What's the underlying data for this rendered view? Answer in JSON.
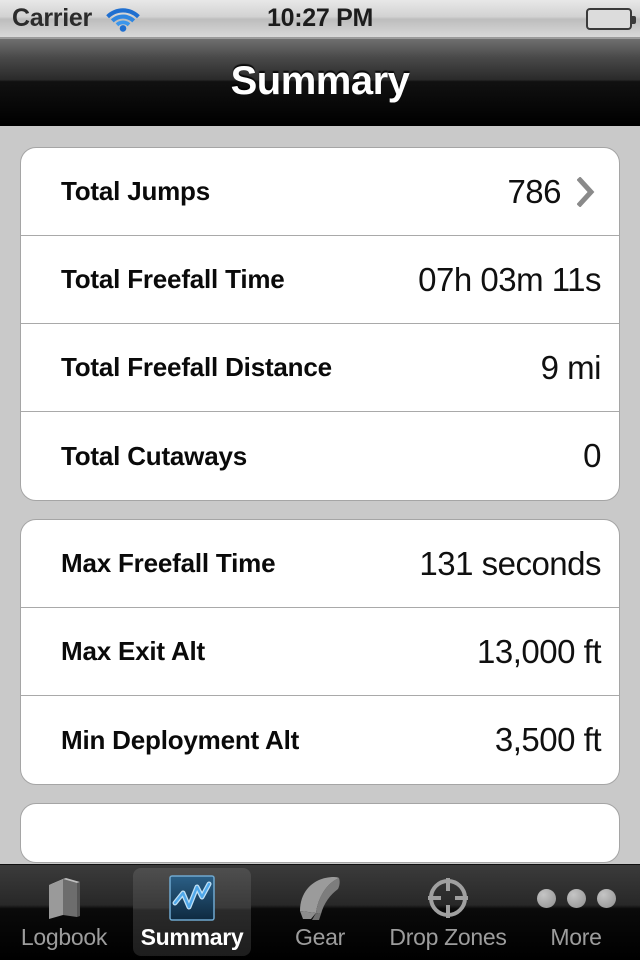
{
  "status_bar": {
    "carrier": "Carrier",
    "wifi_icon": "wifi-icon",
    "time": "10:27 PM",
    "battery_icon": "battery-full-icon"
  },
  "nav_bar": {
    "title": "Summary"
  },
  "groups": [
    {
      "rows": [
        {
          "label": "Total Jumps",
          "value": "786",
          "chevron": true
        },
        {
          "label": "Total Freefall Time",
          "value": "07h 03m 11s",
          "chevron": false
        },
        {
          "label": "Total Freefall Distance",
          "value": "9 mi",
          "chevron": false
        },
        {
          "label": "Total Cutaways",
          "value": "0",
          "chevron": false
        }
      ]
    },
    {
      "rows": [
        {
          "label": "Max Freefall Time",
          "value": "131 seconds",
          "chevron": false
        },
        {
          "label": "Max Exit Alt",
          "value": "13,000 ft",
          "chevron": false
        },
        {
          "label": "Min Deployment Alt",
          "value": "3,500 ft",
          "chevron": false
        }
      ]
    }
  ],
  "tab_bar": {
    "tabs": [
      {
        "label": "Logbook",
        "icon": "book-icon",
        "active": false
      },
      {
        "label": "Summary",
        "icon": "chart-icon",
        "active": true
      },
      {
        "label": "Gear",
        "icon": "parachute-icon",
        "active": false
      },
      {
        "label": "Drop Zones",
        "icon": "target-icon",
        "active": false
      },
      {
        "label": "More",
        "icon": "ellipsis-icon",
        "active": false
      }
    ]
  },
  "colors": {
    "background": "#c9c9c9",
    "card": "#ffffff",
    "accent_blue": "#3b8fe0",
    "battery_green": "#68c322",
    "nav_text": "#ffffff"
  }
}
